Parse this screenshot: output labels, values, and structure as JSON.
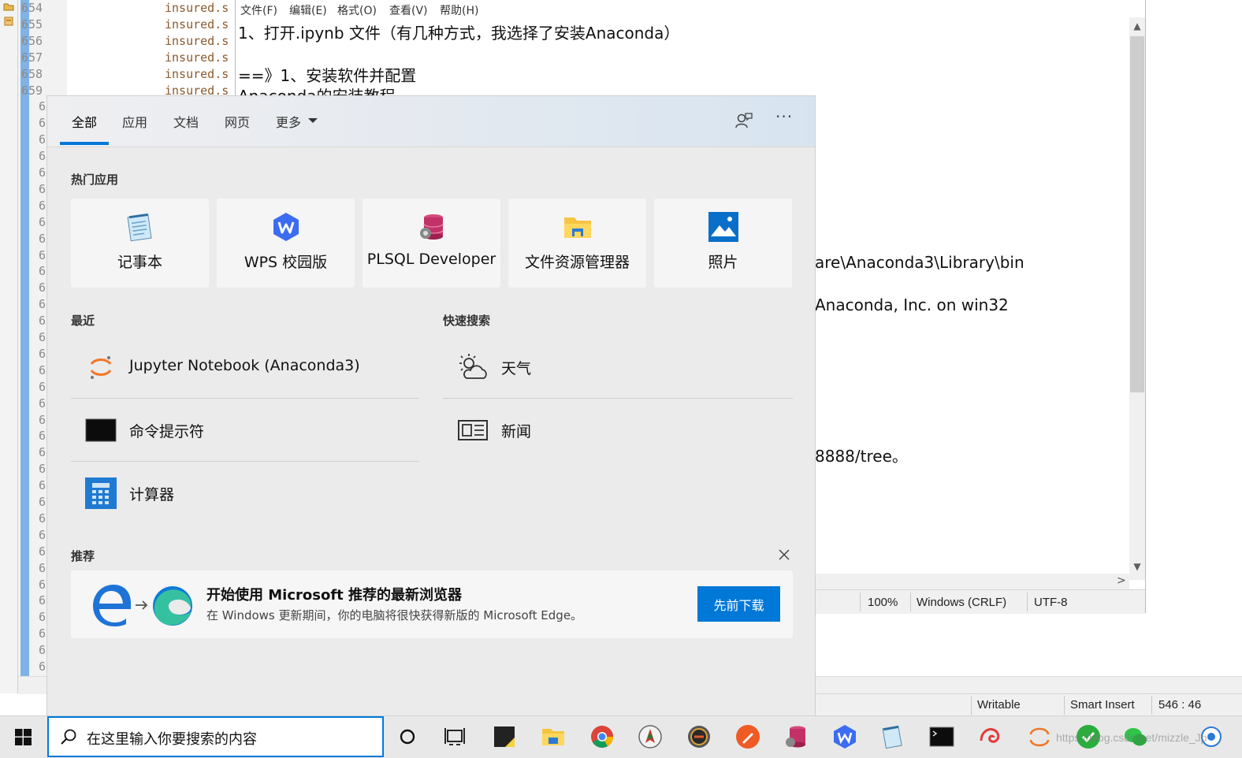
{
  "editor": {
    "line_numbers": [
      "654",
      "655",
      "656",
      "657",
      "658",
      "659"
    ],
    "partial_line_numbers": [
      "6",
      "6",
      "6",
      "6",
      "6",
      "6",
      "6",
      "6",
      "6",
      "6",
      "6",
      "6",
      "6",
      "6",
      "6",
      "6",
      "6",
      "6",
      "6",
      "6",
      "6",
      "6",
      "6",
      "6",
      "6",
      "6",
      "6",
      "6",
      "6",
      "6",
      "6",
      "6",
      "6",
      "6",
      "6",
      "6"
    ],
    "code_text": "insured.s"
  },
  "notepad": {
    "menu": [
      "文件(F)",
      "编辑(E)",
      "格式(O)",
      "查看(V)",
      "帮助(H)"
    ],
    "lines": {
      "l1": "1、打开.ipynb 文件（有几种方式，我选择了安装Anaconda）",
      "l2": "==》1、安装软件并配置",
      "l3": "Anaconda的安装教程",
      "l4": "are\\Anaconda3\\Library\\bin",
      "l5": "Anaconda, Inc. on win32",
      "l6": "8888/tree。"
    },
    "status": {
      "zoom": "100%",
      "eol": "Windows (CRLF)",
      "encoding": "UTF-8"
    }
  },
  "editor_status": {
    "mode": "Writable",
    "insert": "Smart Insert",
    "position": "546 : 46"
  },
  "search": {
    "tabs": [
      "全部",
      "应用",
      "文档",
      "网页",
      "更多"
    ],
    "hot_apps_label": "热门应用",
    "apps": [
      "记事本",
      "WPS 校园版",
      "PLSQL Developer",
      "文件资源管理器",
      "照片"
    ],
    "recent_label": "最近",
    "recent": [
      "Jupyter Notebook (Anaconda3)",
      "命令提示符",
      "计算器"
    ],
    "quick_label": "快速搜索",
    "quick": [
      "天气",
      "新闻"
    ],
    "reco_label": "推荐",
    "reco_title": "开始使用 Microsoft 推荐的最新浏览器",
    "reco_desc": "在 Windows 更新期间，你的电脑将很快获得新版的 Microsoft Edge。",
    "reco_button": "先前下载"
  },
  "taskbar": {
    "search_placeholder": "在这里输入你要搜索的内容",
    "watermark": "https://blog.csdn.net/mizzle_Jp"
  },
  "colors": {
    "accent": "#0078d7",
    "panel_bg": "#ebebeb",
    "card_bg": "#f5f5f5"
  }
}
